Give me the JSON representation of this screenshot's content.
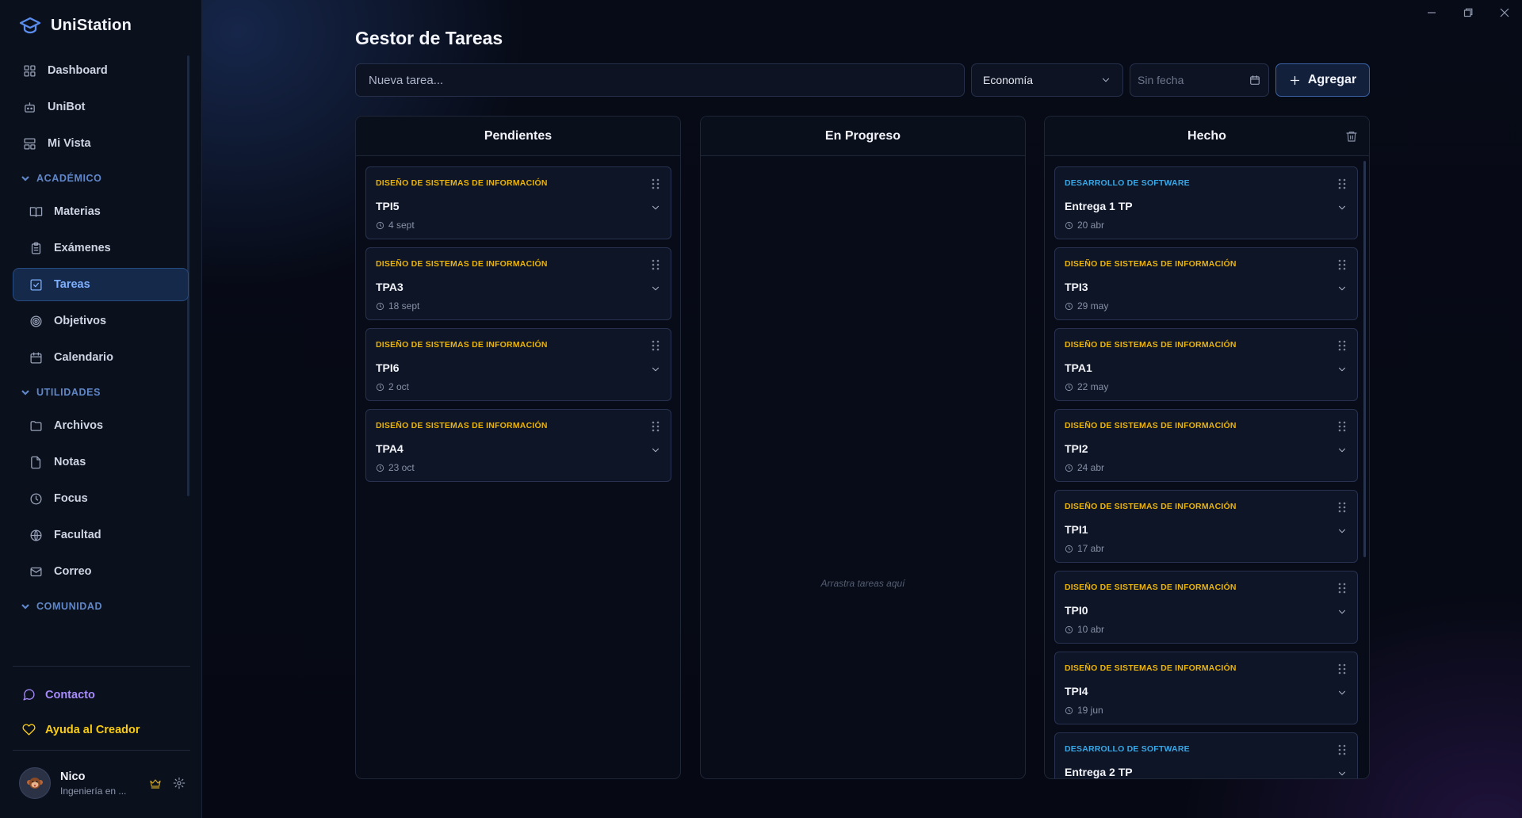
{
  "app": {
    "name": "UniStation"
  },
  "sidebar": {
    "top_items": [
      {
        "label": "Dashboard",
        "icon": "dashboard-icon"
      },
      {
        "label": "UniBot",
        "icon": "bot-icon"
      },
      {
        "label": "Mi Vista",
        "icon": "layout-icon"
      }
    ],
    "sections": [
      {
        "label": "ACADÉMICO",
        "items": [
          {
            "label": "Materias",
            "icon": "book-icon"
          },
          {
            "label": "Exámenes",
            "icon": "clipboard-icon"
          },
          {
            "label": "Tareas",
            "icon": "checkbox-icon",
            "active": true
          },
          {
            "label": "Objetivos",
            "icon": "target-icon"
          },
          {
            "label": "Calendario",
            "icon": "calendar-icon"
          }
        ]
      },
      {
        "label": "UTILIDADES",
        "items": [
          {
            "label": "Archivos",
            "icon": "folder-icon"
          },
          {
            "label": "Notas",
            "icon": "file-icon"
          },
          {
            "label": "Focus",
            "icon": "clock-icon"
          },
          {
            "label": "Facultad",
            "icon": "globe-icon"
          },
          {
            "label": "Correo",
            "icon": "mail-icon"
          }
        ]
      },
      {
        "label": "COMUNIDAD",
        "items": []
      }
    ],
    "contact": {
      "label": "Contacto",
      "color": "#a78bfa"
    },
    "support": {
      "label": "Ayuda al Creador",
      "color": "#facc15"
    },
    "user": {
      "name": "Nico",
      "career": "Ingeniería en ..."
    }
  },
  "main": {
    "title": "Gestor de Tareas",
    "new_task": {
      "placeholder": "Nueva tarea...",
      "value": ""
    },
    "subject_select": {
      "value": "Economía"
    },
    "date_field": {
      "placeholder": "Sin fecha"
    },
    "add_button": {
      "label": "Agregar"
    },
    "empty_hint": "Arrastra tareas aquí",
    "columns": [
      {
        "title": "Pendientes",
        "cards": [
          {
            "category": "DISEÑO DE SISTEMAS DE INFORMACIÓN",
            "kind": "dsi",
            "title": "TPI5",
            "date": "4 sept"
          },
          {
            "category": "DISEÑO DE SISTEMAS DE INFORMACIÓN",
            "kind": "dsi",
            "title": "TPA3",
            "date": "18 sept"
          },
          {
            "category": "DISEÑO DE SISTEMAS DE INFORMACIÓN",
            "kind": "dsi",
            "title": "TPI6",
            "date": "2 oct"
          },
          {
            "category": "DISEÑO DE SISTEMAS DE INFORMACIÓN",
            "kind": "dsi",
            "title": "TPA4",
            "date": "23 oct"
          }
        ]
      },
      {
        "title": "En Progreso",
        "cards": []
      },
      {
        "title": "Hecho",
        "cards": [
          {
            "category": "DESARROLLO DE SOFTWARE",
            "kind": "ds",
            "title": "Entrega 1 TP",
            "date": "20 abr"
          },
          {
            "category": "DISEÑO DE SISTEMAS DE INFORMACIÓN",
            "kind": "dsi",
            "title": "TPI3",
            "date": "29 may"
          },
          {
            "category": "DISEÑO DE SISTEMAS DE INFORMACIÓN",
            "kind": "dsi",
            "title": "TPA1",
            "date": "22 may"
          },
          {
            "category": "DISEÑO DE SISTEMAS DE INFORMACIÓN",
            "kind": "dsi",
            "title": "TPI2",
            "date": "24 abr"
          },
          {
            "category": "DISEÑO DE SISTEMAS DE INFORMACIÓN",
            "kind": "dsi",
            "title": "TPI1",
            "date": "17 abr"
          },
          {
            "category": "DISEÑO DE SISTEMAS DE INFORMACIÓN",
            "kind": "dsi",
            "title": "TPI0",
            "date": "10 abr"
          },
          {
            "category": "DISEÑO DE SISTEMAS DE INFORMACIÓN",
            "kind": "dsi",
            "title": "TPI4",
            "date": "19 jun"
          },
          {
            "category": "DESARROLLO DE SOFTWARE",
            "kind": "ds",
            "title": "Entrega 2 TP",
            "date": ""
          }
        ]
      }
    ]
  },
  "colors": {
    "accent": "#7fb0ff",
    "dsi_tag": "#eab308",
    "ds_tag": "#39a7e6",
    "section": "#5f87c9"
  }
}
